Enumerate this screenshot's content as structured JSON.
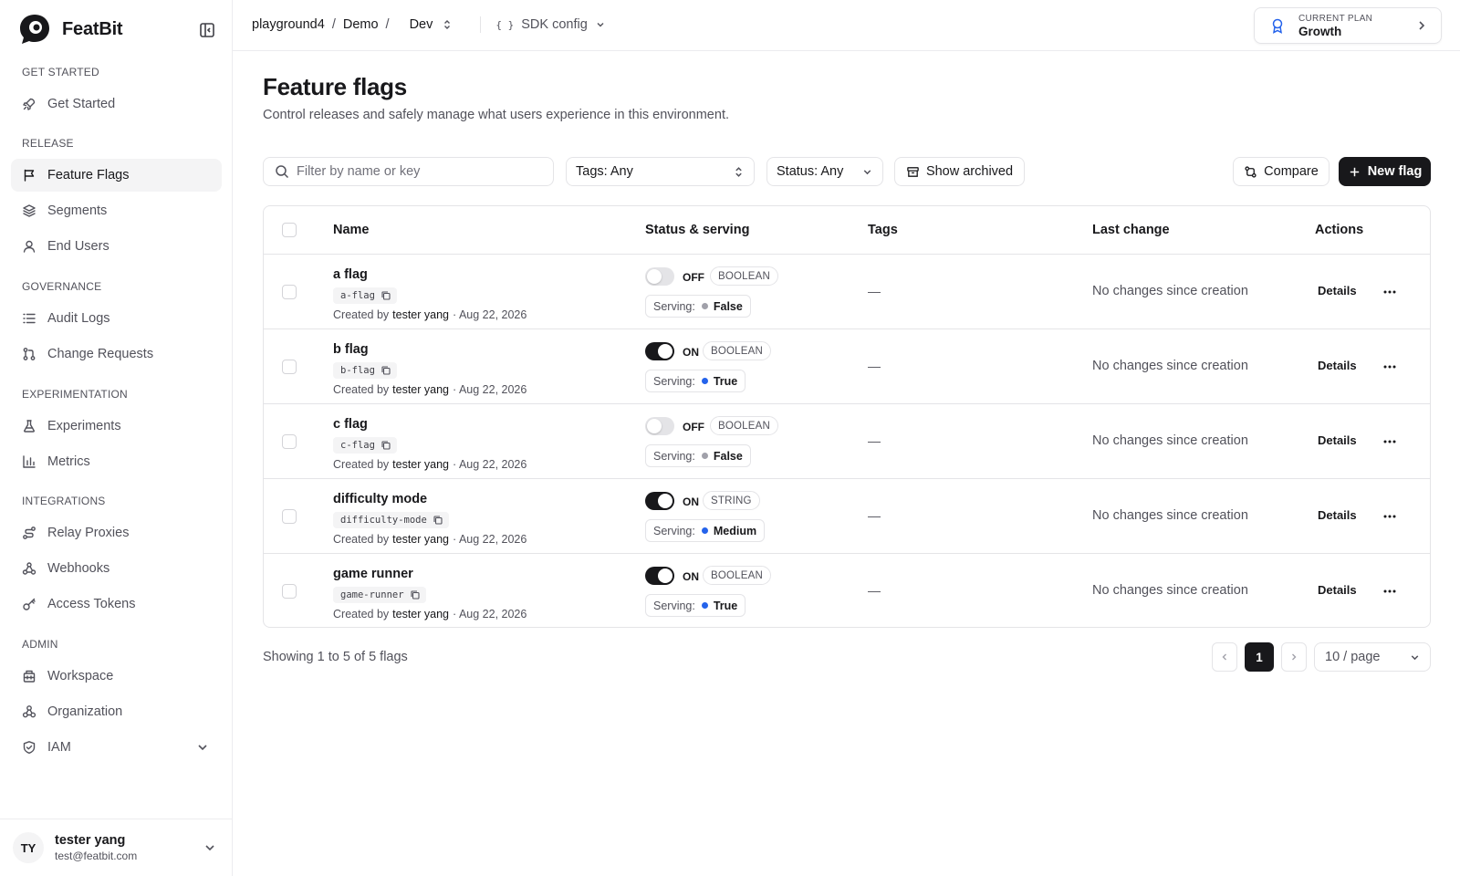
{
  "brand": {
    "name": "FeatBit"
  },
  "sidebar": {
    "sections": [
      {
        "label": "GET STARTED",
        "items": [
          {
            "label": "Get Started",
            "icon": "rocket-icon"
          }
        ]
      },
      {
        "label": "RELEASE",
        "items": [
          {
            "label": "Feature Flags",
            "icon": "flag-icon",
            "active": true
          },
          {
            "label": "Segments",
            "icon": "layers-icon"
          },
          {
            "label": "End Users",
            "icon": "user-icon"
          }
        ]
      },
      {
        "label": "GOVERNANCE",
        "items": [
          {
            "label": "Audit Logs",
            "icon": "list-icon"
          },
          {
            "label": "Change Requests",
            "icon": "git-pull-request-icon"
          }
        ]
      },
      {
        "label": "EXPERIMENTATION",
        "items": [
          {
            "label": "Experiments",
            "icon": "flask-icon"
          },
          {
            "label": "Metrics",
            "icon": "bar-chart-icon"
          }
        ]
      },
      {
        "label": "INTEGRATIONS",
        "items": [
          {
            "label": "Relay Proxies",
            "icon": "route-icon"
          },
          {
            "label": "Webhooks",
            "icon": "webhook-icon"
          },
          {
            "label": "Access Tokens",
            "icon": "key-icon"
          }
        ]
      },
      {
        "label": "ADMIN",
        "items": [
          {
            "label": "Workspace",
            "icon": "building-icon"
          },
          {
            "label": "Organization",
            "icon": "organization-icon"
          },
          {
            "label": "IAM",
            "icon": "shield-icon",
            "expandable": true
          }
        ]
      }
    ]
  },
  "user": {
    "initials": "TY",
    "name": "tester yang",
    "email": "test@featbit.com"
  },
  "topbar": {
    "breadcrumb": [
      "playground4",
      "Demo",
      "Dev"
    ],
    "sdk_config_label": "SDK config",
    "plan": {
      "label": "CURRENT PLAN",
      "name": "Growth"
    }
  },
  "page": {
    "title": "Feature flags",
    "subtitle": "Control releases and safely manage what users experience in this environment."
  },
  "filters": {
    "search_placeholder": "Filter by name or key",
    "search_value": "",
    "tags_label": "Tags: Any",
    "status_label": "Status: Any",
    "show_archived_label": "Show archived",
    "compare_label": "Compare",
    "new_flag_label": "New flag"
  },
  "table": {
    "columns": [
      "Name",
      "Status & serving",
      "Tags",
      "Last change",
      "Actions"
    ],
    "created_by_prefix": "Created by",
    "serving_prefix": "Serving:",
    "details_label": "Details",
    "rows": [
      {
        "name": "a flag",
        "key": "a-flag",
        "creator": "tester yang",
        "date": "· Aug 22, 2026",
        "on": false,
        "state": "OFF",
        "type": "BOOLEAN",
        "serving": "False",
        "serving_color": "#a1a1aa",
        "tags": "—",
        "last_change": "No changes since creation"
      },
      {
        "name": "b flag",
        "key": "b-flag",
        "creator": "tester yang",
        "date": "· Aug 22, 2026",
        "on": true,
        "state": "ON",
        "type": "BOOLEAN",
        "serving": "True",
        "serving_color": "#2563eb",
        "tags": "—",
        "last_change": "No changes since creation"
      },
      {
        "name": "c flag",
        "key": "c-flag",
        "creator": "tester yang",
        "date": "· Aug 22, 2026",
        "on": false,
        "state": "OFF",
        "type": "BOOLEAN",
        "serving": "False",
        "serving_color": "#a1a1aa",
        "tags": "—",
        "last_change": "No changes since creation"
      },
      {
        "name": "difficulty mode",
        "key": "difficulty-mode",
        "creator": "tester yang",
        "date": "· Aug 22, 2026",
        "on": true,
        "state": "ON",
        "type": "STRING",
        "serving": "Medium",
        "serving_color": "#2563eb",
        "tags": "—",
        "last_change": "No changes since creation"
      },
      {
        "name": "game runner",
        "key": "game-runner",
        "creator": "tester yang",
        "date": "· Aug 22, 2026",
        "on": true,
        "state": "ON",
        "type": "BOOLEAN",
        "serving": "True",
        "serving_color": "#2563eb",
        "tags": "—",
        "last_change": "No changes since creation"
      }
    ]
  },
  "pagination": {
    "summary": "Showing 1 to 5 of 5 flags",
    "current_page": "1",
    "page_size_label": "10 / page"
  }
}
